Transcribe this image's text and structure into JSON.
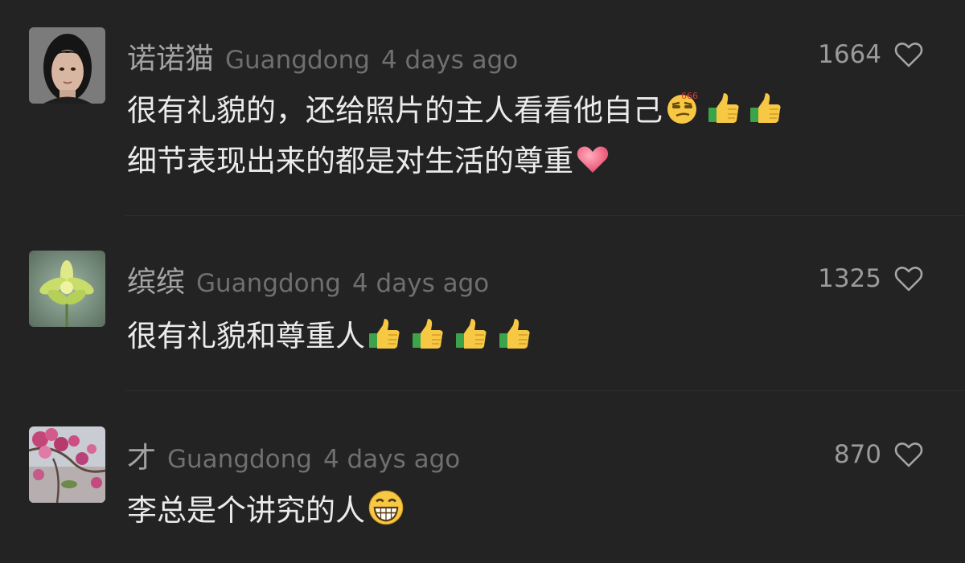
{
  "comments": [
    {
      "username": "诺诺猫",
      "location": "Guangdong",
      "time": "4 days ago",
      "likes": "1664",
      "lines": [
        "很有礼貌的，还给照片的主人看看他自己",
        "细节表现出来的都是对生活的尊重"
      ],
      "line1_emojis": [
        "smirk-666-emoji",
        "thumbs-up-emoji",
        "thumbs-up-emoji"
      ],
      "line2_emojis": [
        "heart-emoji"
      ],
      "emoji_badge": "666"
    },
    {
      "username": "缤缤",
      "location": "Guangdong",
      "time": "4 days ago",
      "likes": "1325",
      "lines": [
        "很有礼貌和尊重人"
      ],
      "line1_emojis": [
        "thumbs-up-emoji",
        "thumbs-up-emoji",
        "thumbs-up-emoji",
        "thumbs-up-emoji"
      ]
    },
    {
      "username": "才",
      "location": "Guangdong",
      "time": "4 days ago",
      "likes": "870",
      "lines": [
        "李总是个讲究的人"
      ],
      "line1_emojis": [
        "grin-emoji"
      ]
    }
  ],
  "colors": {
    "background": "#232323",
    "username": "#a3a3a3",
    "meta": "#6f6f6f",
    "body_text": "#ebebeb"
  },
  "icons": [
    "heart-outline-icon"
  ]
}
